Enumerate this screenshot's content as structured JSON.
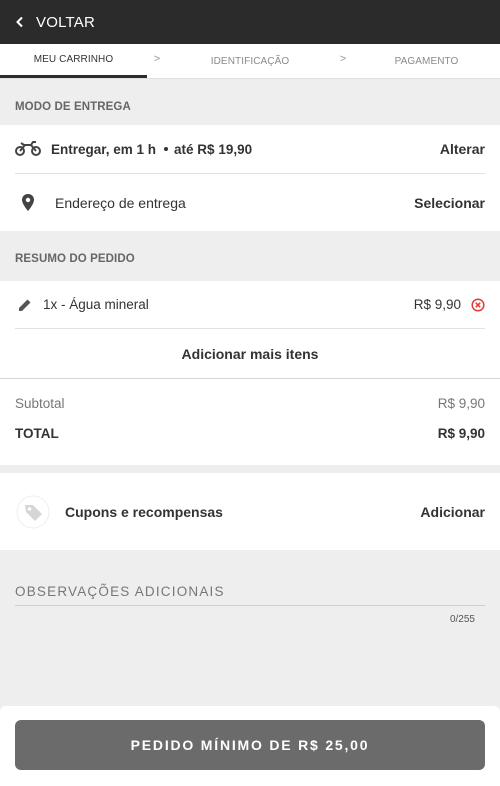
{
  "topbar": {
    "back_label": "VOLTAR"
  },
  "steps": [
    {
      "label": "MEU CARRINHO"
    },
    {
      "label": "IDENTIFICAÇÃO"
    },
    {
      "label": "PAGAMENTO"
    }
  ],
  "step_separator": ">",
  "delivery": {
    "section_title": "MODO DE ENTREGA",
    "mode_label": "Entregar, em 1 h",
    "mode_price": "até R$ 19,90",
    "mode_action": "Alterar",
    "address_label": "Endereço de entrega",
    "address_action": "Selecionar"
  },
  "order": {
    "section_title": "RESUMO DO PEDIDO",
    "items": [
      {
        "label": "1x - Água mineral",
        "price": "R$ 9,90"
      }
    ],
    "add_more_label": "Adicionar mais itens",
    "subtotal_label": "Subtotal",
    "subtotal_value": "R$ 9,90",
    "total_label": "TOTAL",
    "total_value": "R$ 9,90"
  },
  "coupon": {
    "label": "Cupons e recompensas",
    "action": "Adicionar"
  },
  "notes": {
    "label": "OBSERVAÇÕES ADICIONAIS",
    "counter": "0/255"
  },
  "footer": {
    "cta_label": "PEDIDO MÍNIMO DE R$ 25,00"
  },
  "colors": {
    "topbar": "#2b2b2b",
    "cta": "#6b6b6b",
    "remove_icon": "#e53935"
  },
  "icons": [
    "chevron-left-icon",
    "motorcycle-icon",
    "location-pin-icon",
    "pencil-icon",
    "remove-circle-icon",
    "tag-icon"
  ]
}
